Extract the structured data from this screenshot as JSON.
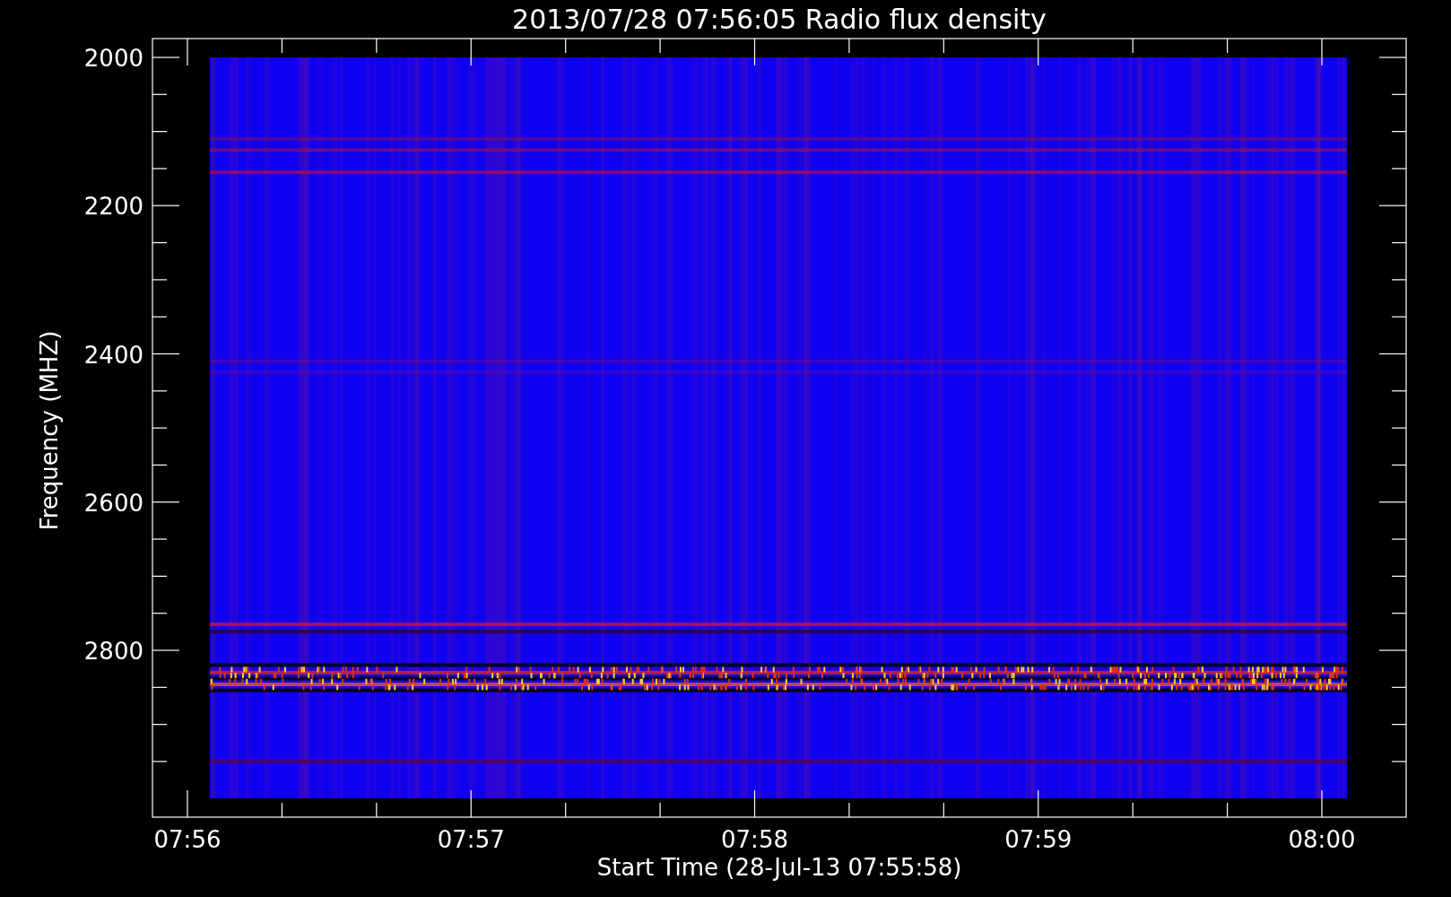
{
  "plot": {
    "title": "2013/07/28 07:56:05 Radio flux density",
    "ylabel": "Frequency (MHZ)",
    "xlabel": "Start Time (28-Jul-13 07:55:58)",
    "yticks": [
      "2000",
      "2200",
      "2400",
      "2600",
      "2800"
    ],
    "xticks": [
      "07:56",
      "07:57",
      "07:58",
      "07:59",
      "08:00"
    ]
  }
}
